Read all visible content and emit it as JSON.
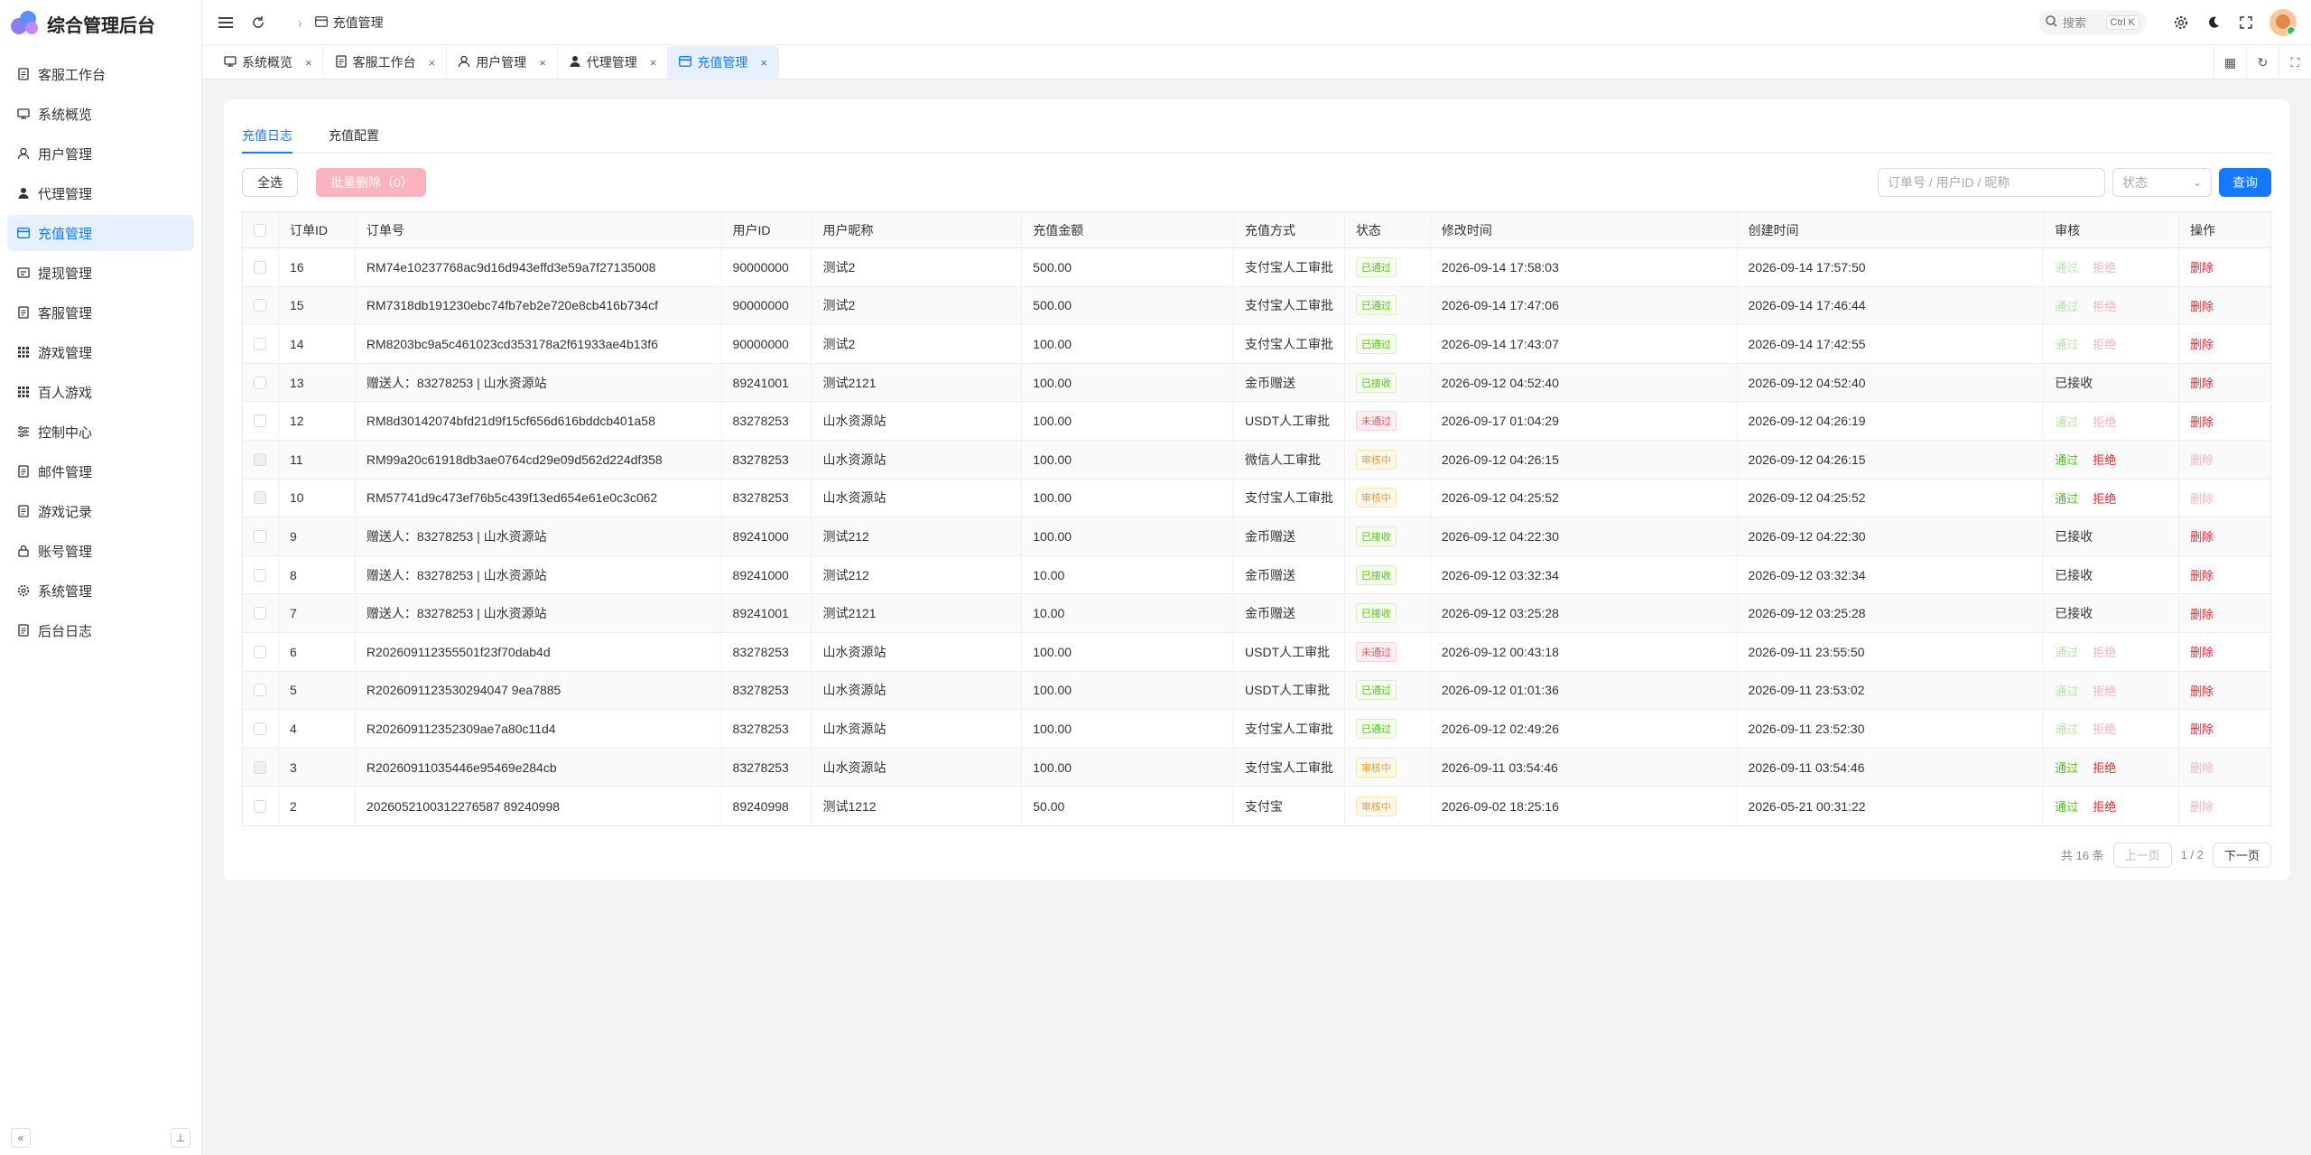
{
  "app": {
    "title": "综合管理后台"
  },
  "sidebar": {
    "items": [
      {
        "label": "客服工作台",
        "icon": "document-icon"
      },
      {
        "label": "系统概览",
        "icon": "chart-icon"
      },
      {
        "label": "用户管理",
        "icon": "user-icon"
      },
      {
        "label": "代理管理",
        "icon": "user-solid-icon"
      },
      {
        "label": "充值管理",
        "icon": "card-icon",
        "active": true
      },
      {
        "label": "提现管理",
        "icon": "withdraw-icon"
      },
      {
        "label": "客服管理",
        "icon": "document-icon"
      },
      {
        "label": "游戏管理",
        "icon": "grid-icon"
      },
      {
        "label": "百人游戏",
        "icon": "grid-icon"
      },
      {
        "label": "控制中心",
        "icon": "sliders-icon"
      },
      {
        "label": "邮件管理",
        "icon": "document-icon"
      },
      {
        "label": "游戏记录",
        "icon": "document-icon"
      },
      {
        "label": "账号管理",
        "icon": "lock-icon"
      },
      {
        "label": "系统管理",
        "icon": "gear-icon"
      },
      {
        "label": "后台日志",
        "icon": "document-icon"
      }
    ],
    "collapse_glyph": "«",
    "pin_glyph": "⊥"
  },
  "header": {
    "breadcrumb": "充值管理",
    "search_label": "搜索",
    "search_kbd": "Ctrl K"
  },
  "tabs": [
    {
      "label": "系统概览",
      "icon": "chart-icon"
    },
    {
      "label": "客服工作台",
      "icon": "document-icon"
    },
    {
      "label": "用户管理",
      "icon": "user-icon"
    },
    {
      "label": "代理管理",
      "icon": "user-solid-icon"
    },
    {
      "label": "充值管理",
      "icon": "card-icon",
      "active": true
    }
  ],
  "subtabs": [
    {
      "label": "充值日志",
      "active": true
    },
    {
      "label": "充值配置",
      "active": false
    }
  ],
  "toolbar": {
    "select_all": "全选",
    "batch_delete": "批量删除（0）",
    "order_placeholder": "订单号 / 用户ID / 昵称",
    "status_placeholder": "状态",
    "query": "查询"
  },
  "table": {
    "columns": [
      "订单ID",
      "订单号",
      "用户ID",
      "用户昵称",
      "充值金额",
      "充值方式",
      "状态",
      "修改时间",
      "创建时间",
      "审核",
      "操作"
    ],
    "rows": [
      {
        "id": "16",
        "order": "RM74e10237768ac9d16d943effd3e59a7f27135008",
        "uid": "90000000",
        "nick": "测试2",
        "amount": "500.00",
        "method": "支付宝人工审批",
        "status": "已通过",
        "status_type": "approved",
        "modified": "2026-09-14 17:58:03",
        "created": "2026-09-14 17:57:50",
        "review": "buttons",
        "review_enabled": false,
        "delete_enabled": true,
        "check_disabled": false
      },
      {
        "id": "15",
        "order": "RM7318db191230ebc74fb7eb2e720e8cb416b734cf",
        "uid": "90000000",
        "nick": "测试2",
        "amount": "500.00",
        "method": "支付宝人工审批",
        "status": "已通过",
        "status_type": "approved",
        "modified": "2026-09-14 17:47:06",
        "created": "2026-09-14 17:46:44",
        "review": "buttons",
        "review_enabled": false,
        "delete_enabled": true,
        "check_disabled": false
      },
      {
        "id": "14",
        "order": "RM8203bc9a5c461023cd353178a2f61933ae4b13f6",
        "uid": "90000000",
        "nick": "测试2",
        "amount": "100.00",
        "method": "支付宝人工审批",
        "status": "已通过",
        "status_type": "approved",
        "modified": "2026-09-14 17:43:07",
        "created": "2026-09-14 17:42:55",
        "review": "buttons",
        "review_enabled": false,
        "delete_enabled": true,
        "check_disabled": false
      },
      {
        "id": "13",
        "order": "赠送人：83278253 | 山水资源站",
        "uid": "89241001",
        "nick": "测试2121",
        "amount": "100.00",
        "method": "金币赠送",
        "status": "已接收",
        "status_type": "received",
        "modified": "2026-09-12 04:52:40",
        "created": "2026-09-12 04:52:40",
        "review": "已接收",
        "review_enabled": false,
        "delete_enabled": true,
        "check_disabled": false
      },
      {
        "id": "12",
        "order": "RM8d30142074bfd21d9f15cf656d616bddcb401a58",
        "uid": "83278253",
        "nick": "山水资源站",
        "amount": "100.00",
        "method": "USDT人工审批",
        "status": "未通过",
        "status_type": "rejected",
        "modified": "2026-09-17 01:04:29",
        "created": "2026-09-12 04:26:19",
        "review": "buttons",
        "review_enabled": false,
        "delete_enabled": true,
        "check_disabled": false
      },
      {
        "id": "11",
        "order": "RM99a20c61918db3ae0764cd29e09d562d224df358",
        "uid": "83278253",
        "nick": "山水资源站",
        "amount": "100.00",
        "method": "微信人工审批",
        "status": "审核中",
        "status_type": "pending",
        "modified": "2026-09-12 04:26:15",
        "created": "2026-09-12 04:26:15",
        "review": "buttons",
        "review_enabled": true,
        "delete_enabled": false,
        "check_disabled": true
      },
      {
        "id": "10",
        "order": "RM57741d9c473ef76b5c439f13ed654e61e0c3c062",
        "uid": "83278253",
        "nick": "山水资源站",
        "amount": "100.00",
        "method": "支付宝人工审批",
        "status": "审核中",
        "status_type": "pending",
        "modified": "2026-09-12 04:25:52",
        "created": "2026-09-12 04:25:52",
        "review": "buttons",
        "review_enabled": true,
        "delete_enabled": false,
        "check_disabled": true
      },
      {
        "id": "9",
        "order": "赠送人：83278253 | 山水资源站",
        "uid": "89241000",
        "nick": "测试212",
        "amount": "100.00",
        "method": "金币赠送",
        "status": "已接收",
        "status_type": "received",
        "modified": "2026-09-12 04:22:30",
        "created": "2026-09-12 04:22:30",
        "review": "已接收",
        "review_enabled": false,
        "delete_enabled": true,
        "check_disabled": false
      },
      {
        "id": "8",
        "order": "赠送人：83278253 | 山水资源站",
        "uid": "89241000",
        "nick": "测试212",
        "amount": "10.00",
        "method": "金币赠送",
        "status": "已接收",
        "status_type": "received",
        "modified": "2026-09-12 03:32:34",
        "created": "2026-09-12 03:32:34",
        "review": "已接收",
        "review_enabled": false,
        "delete_enabled": true,
        "check_disabled": false
      },
      {
        "id": "7",
        "order": "赠送人：83278253 | 山水资源站",
        "uid": "89241001",
        "nick": "测试2121",
        "amount": "10.00",
        "method": "金币赠送",
        "status": "已接收",
        "status_type": "received",
        "modified": "2026-09-12 03:25:28",
        "created": "2026-09-12 03:25:28",
        "review": "已接收",
        "review_enabled": false,
        "delete_enabled": true,
        "check_disabled": false
      },
      {
        "id": "6",
        "order": "R202609112355501f23f70dab4d",
        "uid": "83278253",
        "nick": "山水资源站",
        "amount": "100.00",
        "method": "USDT人工审批",
        "status": "未通过",
        "status_type": "rejected",
        "modified": "2026-09-12 00:43:18",
        "created": "2026-09-11 23:55:50",
        "review": "buttons",
        "review_enabled": false,
        "delete_enabled": true,
        "check_disabled": false
      },
      {
        "id": "5",
        "order": "R2026091123530294047 9ea7885",
        "uid": "83278253",
        "nick": "山水资源站",
        "amount": "100.00",
        "method": "USDT人工审批",
        "status": "已通过",
        "status_type": "approved",
        "modified": "2026-09-12 01:01:36",
        "created": "2026-09-11 23:53:02",
        "review": "buttons",
        "review_enabled": false,
        "delete_enabled": true,
        "check_disabled": false
      },
      {
        "id": "4",
        "order": "R202609112352309ae7a80c11d4",
        "uid": "83278253",
        "nick": "山水资源站",
        "amount": "100.00",
        "method": "支付宝人工审批",
        "status": "已通过",
        "status_type": "approved",
        "modified": "2026-09-12 02:49:26",
        "created": "2026-09-11 23:52:30",
        "review": "buttons",
        "review_enabled": false,
        "delete_enabled": true,
        "check_disabled": false
      },
      {
        "id": "3",
        "order": "R20260911035446e95469e284cb",
        "uid": "83278253",
        "nick": "山水资源站",
        "amount": "100.00",
        "method": "支付宝人工审批",
        "status": "审核中",
        "status_type": "pending",
        "modified": "2026-09-11 03:54:46",
        "created": "2026-09-11 03:54:46",
        "review": "buttons",
        "review_enabled": true,
        "delete_enabled": false,
        "check_disabled": true
      },
      {
        "id": "2",
        "order": "2026052100312276587 89240998",
        "uid": "89240998",
        "nick": "测试1212",
        "amount": "50.00",
        "method": "支付宝",
        "status": "审核中",
        "status_type": "pending",
        "modified": "2026-09-02 18:25:16",
        "created": "2026-05-21 00:31:22",
        "review": "buttons",
        "review_enabled": true,
        "delete_enabled": false,
        "check_disabled": false
      }
    ],
    "pass_label": "通过",
    "reject_label": "拒绝",
    "delete_label": "删除"
  },
  "pagination": {
    "total": "共 16 条",
    "prev": "上一页",
    "page": "1 / 2",
    "next": "下一页"
  }
}
